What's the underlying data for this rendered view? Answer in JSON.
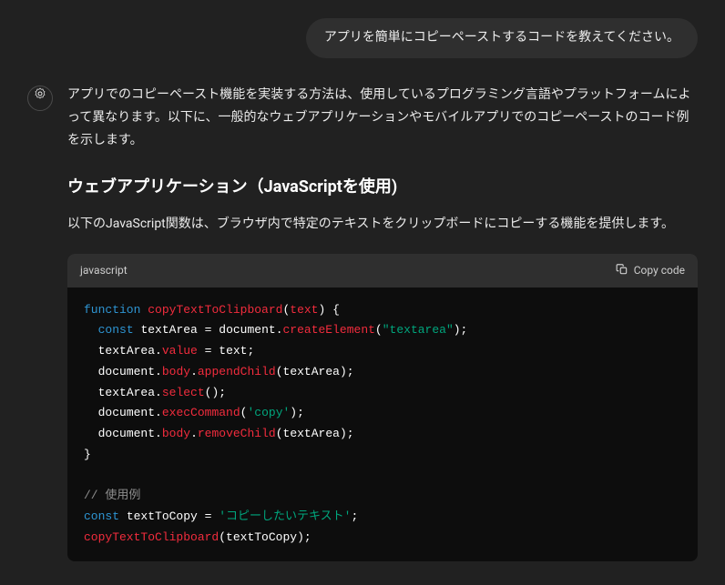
{
  "user": {
    "message": "アプリを簡単にコピーペーストするコードを教えてください。"
  },
  "assistant": {
    "intro": "アプリでのコピーペースト機能を実装する方法は、使用しているプログラミング言語やプラットフォームによって異なります。以下に、一般的なウェブアプリケーションやモバイルアプリでのコピーペーストのコード例を示します。",
    "heading": "ウェブアプリケーション（JavaScriptを使用)",
    "sub": "以下のJavaScript関数は、ブラウザ内で特定のテキストをクリップボードにコピーする機能を提供します。",
    "code": {
      "lang": "javascript",
      "copy_label": "Copy code",
      "tokens": {
        "function": "function",
        "fn_name": "copyTextToClipboard",
        "param": "text",
        "const": "const",
        "textArea": "textArea",
        "eq": " = ",
        "document": "document",
        "createElement": "createElement",
        "textarea_str": "\"textarea\"",
        "value": "value",
        "text_var": "text",
        "body": "body",
        "appendChild": "appendChild",
        "select": "select",
        "execCommand": "execCommand",
        "copy_str": "'copy'",
        "removeChild": "removeChild",
        "comment": "// 使用例",
        "textToCopy": "textToCopy",
        "copy_text_str": "'コピーしたいテキスト'",
        "call_fn": "copyTextToClipboard"
      }
    }
  }
}
